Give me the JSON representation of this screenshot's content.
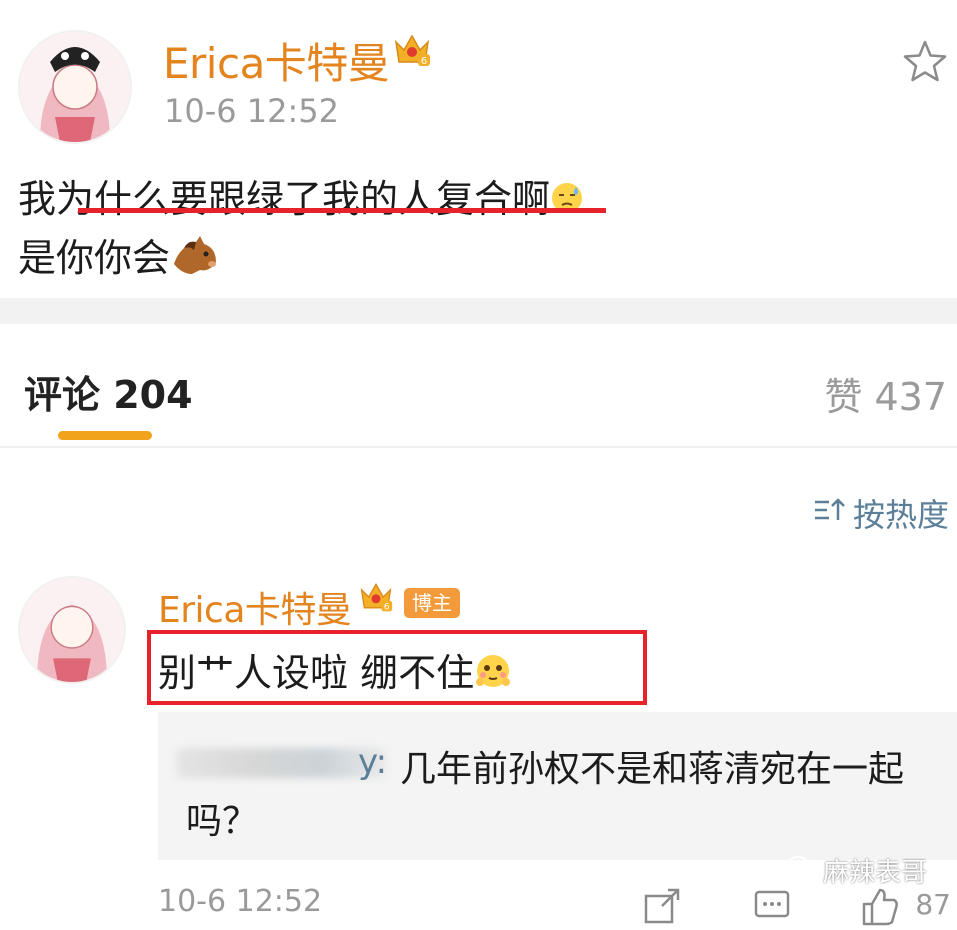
{
  "post": {
    "username": "Erica卡特曼",
    "vip_level": "6",
    "timestamp": "10-6 12:52",
    "line1": "我为什么要跟绿了我的人复合啊",
    "line2": "是你你会",
    "line1_emoji": "sweat-face-emoji",
    "line2_emoji": "horse-emoji"
  },
  "tabs": {
    "comments_label": "评论 204",
    "likes_label": "赞 437"
  },
  "sort": {
    "label": "按热度",
    "icon": "sort-icon"
  },
  "comment": {
    "username": "Erica卡特曼",
    "badge": "博主",
    "text": "别艹人设啦 绷不住",
    "emoji": "shy-face-emoji",
    "timestamp": "10-6 12:52",
    "like_count": "87",
    "reply": {
      "user_suffix": "y:",
      "text_line1": "几年前孙权不是和蒋清宛在一起",
      "text_line2": "吗？"
    }
  },
  "watermark": "麻辣表哥",
  "colors": {
    "username": "#e3841e",
    "accent_red": "#e8222a",
    "tab_indicator": "#f0a31b",
    "link_blue": "#5b7e99"
  }
}
